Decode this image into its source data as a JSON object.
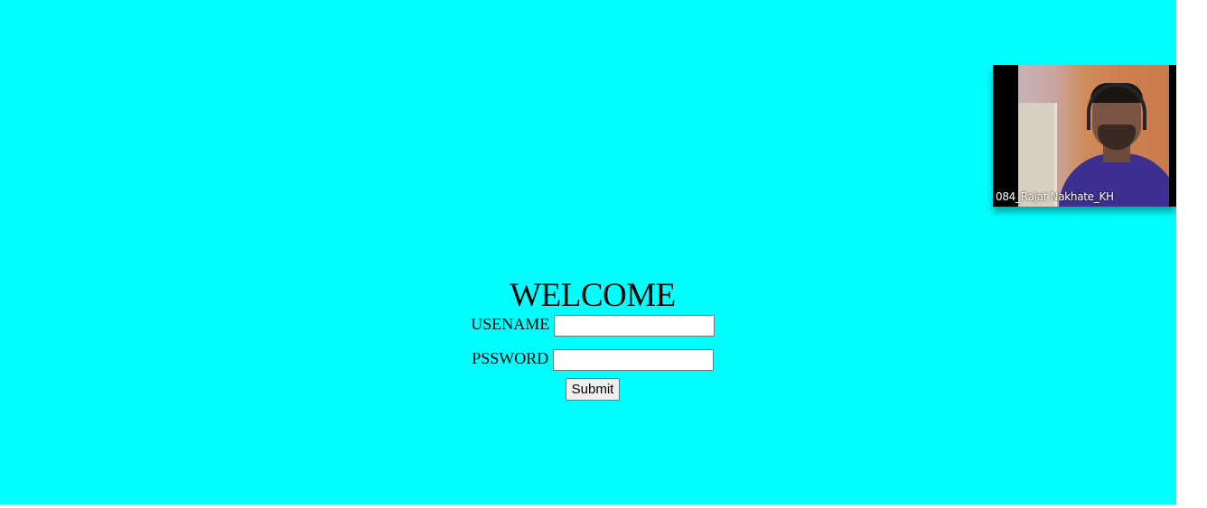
{
  "login": {
    "title": "WELCOME",
    "username_label": "USENAME",
    "username_value": "",
    "password_label": "PSSWORD",
    "password_value": "",
    "submit_label": "Submit"
  },
  "video_call": {
    "participant_name": "084_Rajat Nakhate_KH"
  },
  "colors": {
    "page_background": "#00ffff"
  }
}
